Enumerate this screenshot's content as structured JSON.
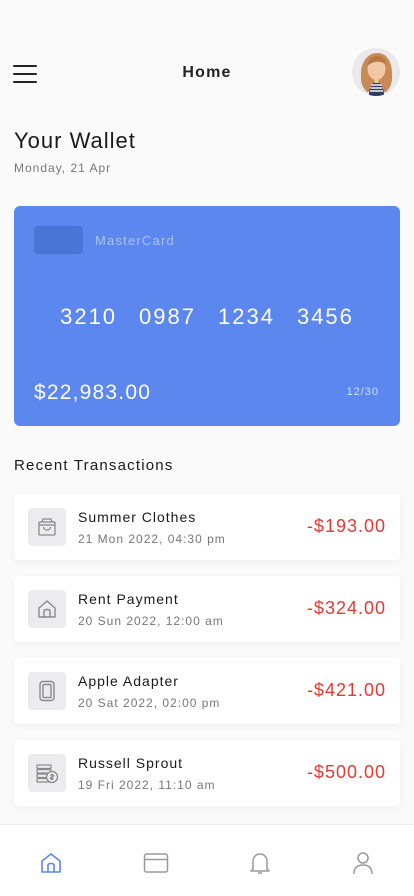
{
  "header": {
    "title": "Home",
    "menu_icon": "hamburger-menu-icon",
    "avatar": "user-avatar"
  },
  "wallet": {
    "title": "Your Wallet",
    "date": "Monday, 21 Apr"
  },
  "card": {
    "brand": "MasterCard",
    "number_groups": [
      "3210",
      "0987",
      "1234",
      "3456"
    ],
    "balance": "$22,983.00",
    "expiry": "12/30",
    "color": "#5b87ee"
  },
  "transactions_section": {
    "title": "Recent Transactions"
  },
  "transactions": [
    {
      "name": "Summer Clothes",
      "date": "21 Mon 2022, 04:30 pm",
      "amount": "-$193.00",
      "icon": "shopping-bag-icon"
    },
    {
      "name": "Rent Payment",
      "date": "20 Sun 2022, 12:00 am",
      "amount": "-$324.00",
      "icon": "house-icon"
    },
    {
      "name": "Apple Adapter",
      "date": "20 Sat 2022, 02:00 pm",
      "amount": "-$421.00",
      "icon": "phone-icon"
    },
    {
      "name": "Russell Sprout",
      "date": "19 Fri 2022, 11:10 am",
      "amount": "-$500.00",
      "icon": "money-icon"
    }
  ],
  "colors": {
    "accent": "#5b87ee",
    "negative": "#e53935"
  },
  "nav": [
    {
      "icon": "home-icon",
      "active": true
    },
    {
      "icon": "credit-card-icon",
      "active": false
    },
    {
      "icon": "bell-icon",
      "active": false
    },
    {
      "icon": "profile-icon",
      "active": false
    }
  ]
}
